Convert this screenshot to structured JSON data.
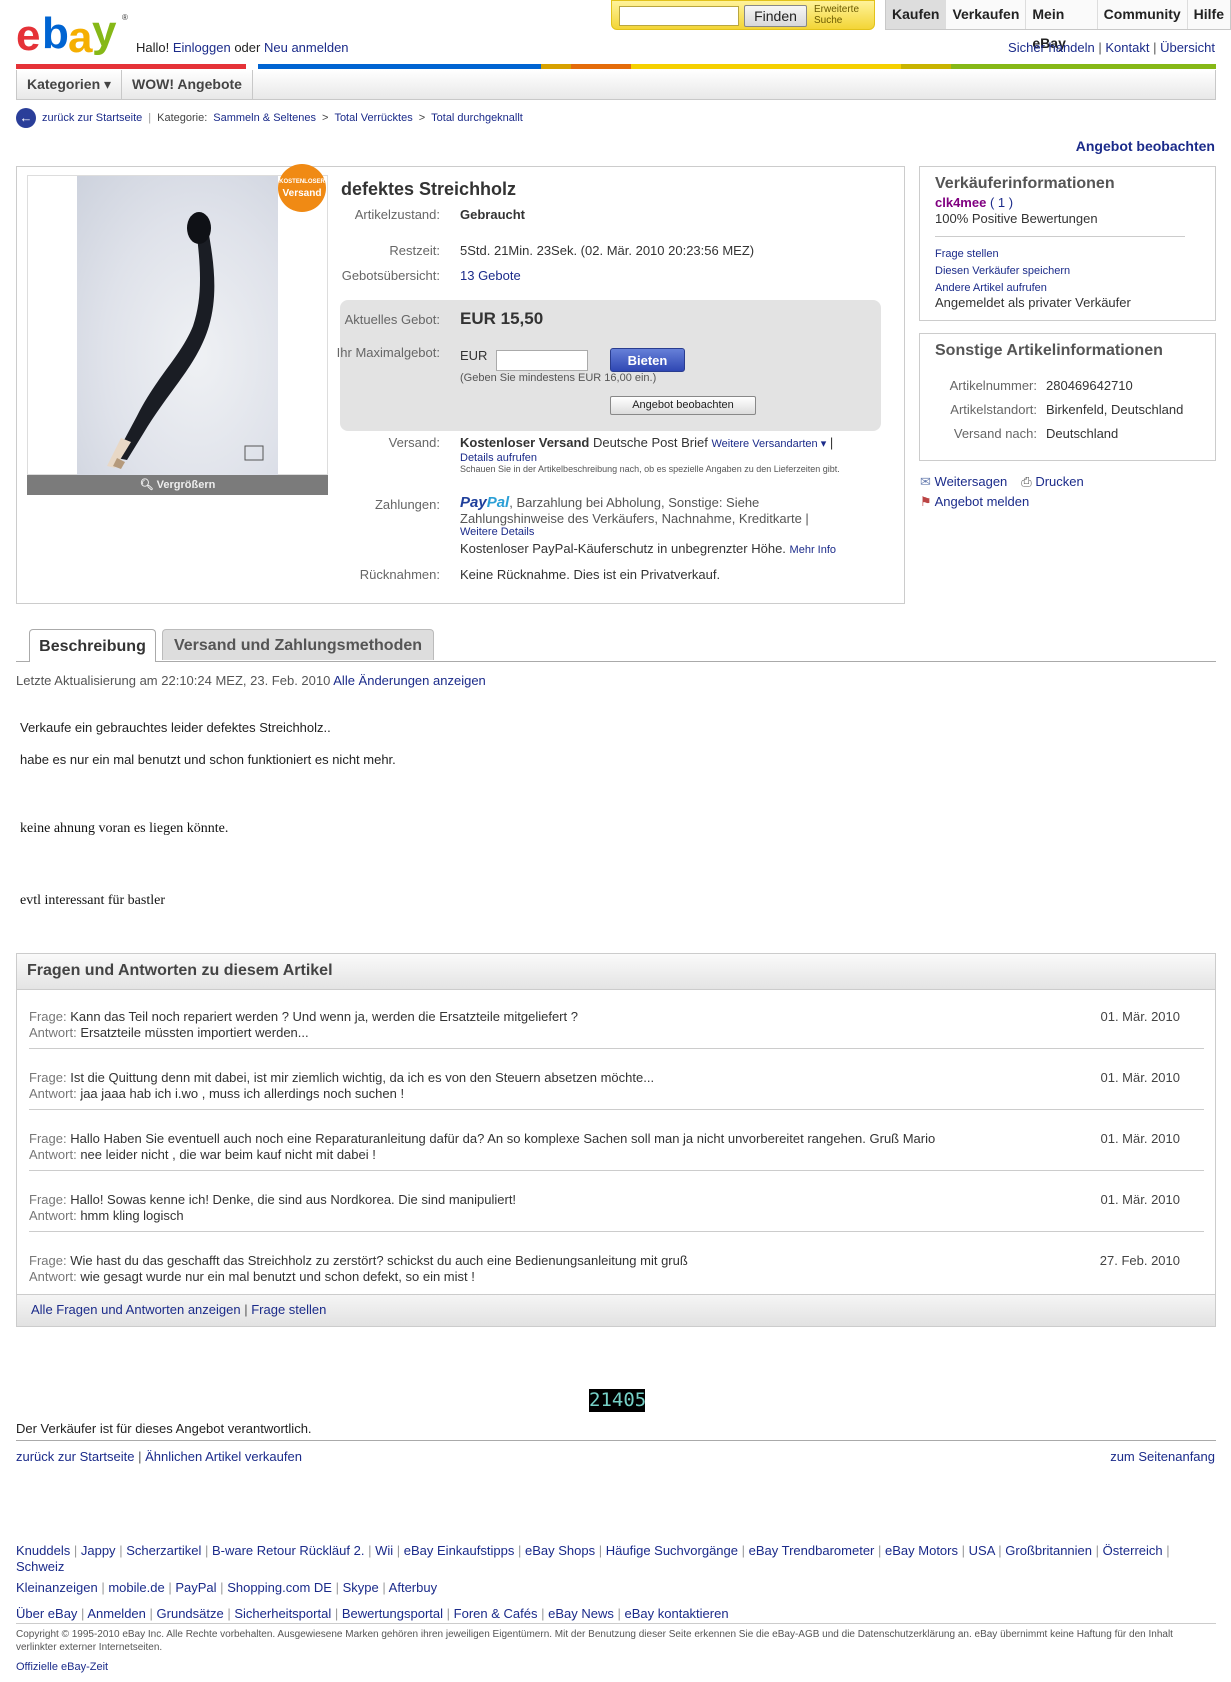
{
  "header": {
    "greeting": "Hallo!",
    "login": "Einloggen",
    "or": "oder",
    "register": "Neu anmelden",
    "search_button": "Finden",
    "advanced_search": [
      "Erweiterte",
      "Suche"
    ],
    "nav": [
      "Kaufen",
      "Verkaufen",
      "Mein eBay",
      "Community",
      "Hilfe"
    ],
    "top_links": [
      "Sicher handeln",
      "Kontakt",
      "Übersicht"
    ],
    "categories_menu": "Kategorien ▾",
    "wow": "WOW! Angebote",
    "logo_letters": [
      "e",
      "b",
      "a",
      "y"
    ],
    "logo_colors": [
      "#e53238",
      "#0064d2",
      "#f5af02",
      "#86b817"
    ]
  },
  "breadcrumb": {
    "back": "zurück zur Startseite",
    "category_label": "Kategorie:",
    "path": [
      "Sammeln & Seltenes",
      "Total Verrücktes",
      "Total durchgeknallt"
    ]
  },
  "watch_top": "Angebot beobachten",
  "item": {
    "title": "defektes Streichholz",
    "free_shipping_badge": [
      "KOSTENLOSER",
      "Versand"
    ],
    "enlarge": "Vergrößern",
    "condition_label": "Artikelzustand:",
    "condition": "Gebraucht",
    "time_left_label": "Restzeit:",
    "time_left": "5Std. 21Min. 23Sek. (02. Mär. 2010 20:23:56 MEZ)",
    "bid_history_label": "Gebotsübersicht:",
    "bid_history": "13 Gebote",
    "current_bid_label": "Aktuelles Gebot:",
    "current_bid": "EUR 15,50",
    "max_bid_label": "Ihr Maximalgebot:",
    "currency": "EUR",
    "bid_button": "Bieten",
    "min_bid_hint": "(Geben Sie mindestens EUR 16,00 ein.)",
    "watch_button": "Angebot beobachten",
    "shipping_label": "Versand:",
    "shipping_free": "Kostenloser Versand",
    "shipping_method": "Deutsche Post Brief",
    "more_shipping": "Weitere Versandarten",
    "details": "Details aufrufen",
    "shipping_note": "Schauen Sie in der Artikelbeschreibung nach, ob es spezielle Angaben zu den Lieferzeiten gibt.",
    "payment_label": "Zahlungen:",
    "paypal_logo": [
      "Pay",
      "Pal"
    ],
    "payment_text": ", Barzahlung bei Abholung, Sonstige: Siehe Zahlungshinweise des Verkäufers, Nachnahme, Kreditkarte |",
    "more_details": "Weitere Details",
    "buyer_protection": "Kostenloser PayPal-Käuferschutz in unbegrenzter Höhe.",
    "more_info": "Mehr Info",
    "returns_label": "Rücknahmen:",
    "returns": "Keine Rücknahme. Dies ist ein Privatverkauf."
  },
  "seller": {
    "title": "Verkäuferinformationen",
    "name": "clk4mee",
    "score": "( 1 )",
    "positive": "100% Positive Bewertungen",
    "links": [
      "Frage stellen",
      "Diesen Verkäufer speichern",
      "Andere Artikel aufrufen"
    ],
    "private": "Angemeldet als privater Verkäufer"
  },
  "other_info": {
    "title": "Sonstige Artikelinformationen",
    "item_number_label": "Artikelnummer:",
    "item_number": "280469642710",
    "location_label": "Artikelstandort:",
    "location": "Birkenfeld, Deutschland",
    "ships_to_label": "Versand nach:",
    "ships_to": "Deutschland"
  },
  "actions": {
    "share": "Weitersagen",
    "print": "Drucken",
    "report": "Angebot melden"
  },
  "tabs": [
    "Beschreibung",
    "Versand und Zahlungsmethoden"
  ],
  "description": {
    "updated": "Letzte Aktualisierung am 22:10:24 MEZ, 23. Feb. 2010",
    "all_changes": "Alle Änderungen anzeigen",
    "line1": "Verkaufe ein gebrauchtes leider defektes Streichholz..",
    "line2": "habe es nur ein mal benutzt und schon funktioniert es nicht mehr.",
    "line3": "keine ahnung voran es liegen könnte.",
    "line4": "evtl interessant für bastler"
  },
  "qa": {
    "title": "Fragen und Antworten zu diesem Artikel",
    "q_label": "Frage:",
    "a_label": "Antwort:",
    "items": [
      {
        "q": "Kann das Teil noch repariert werden ? Und wenn ja, werden die Ersatzteile mitgeliefert ?",
        "a": "Ersatzteile müssten importiert werden...",
        "date": "01. Mär. 2010"
      },
      {
        "q": "Ist die Quittung denn mit dabei, ist mir ziemlich wichtig, da ich es von den Steuern absetzen möchte...",
        "a": "jaa jaaa hab ich i.wo , muss ich allerdings noch suchen !",
        "date": "01. Mär. 2010"
      },
      {
        "q": "Hallo Haben Sie eventuell auch noch eine Reparaturanleitung dafür da? An so komplexe Sachen soll man ja nicht unvorbereitet rangehen. Gruß Mario",
        "a": "nee leider nicht , die war beim kauf nicht mit dabei !",
        "date": "01. Mär. 2010"
      },
      {
        "q": "Hallo! Sowas kenne ich! Denke, die sind aus Nordkorea. Die sind manipuliert!",
        "a": "hmm kling logisch",
        "date": "01. Mär. 2010"
      },
      {
        "q": "Wie hast du das geschafft das Streichholz zu zerstört? schickst du auch eine Bedienungsanleitung mit gruß",
        "a": "wie gesagt wurde nur ein mal benutzt und schon defekt, so ein mist !",
        "date": "27. Feb. 2010"
      }
    ],
    "all_link": "Alle Fragen und Antworten anzeigen",
    "ask_link": "Frage stellen"
  },
  "counter": "21405",
  "responsible": "Der Verkäufer ist für dieses Angebot verantwortlich.",
  "footer_nav": {
    "back": "zurück zur Startseite",
    "sell_similar": "Ähnlichen Artikel verkaufen",
    "top": "zum Seitenanfang"
  },
  "footer_links_1": [
    "Knuddels",
    "Jappy",
    "Scherzartikel",
    "B-ware Retour Rückläuf 2.",
    "Wii",
    "eBay Einkaufstipps",
    "eBay Shops",
    "Häufige Suchvorgänge",
    "eBay Trendbarometer",
    "eBay Motors",
    "USA",
    "Großbritannien",
    "Österreich",
    "Schweiz"
  ],
  "footer_links_2": [
    "Kleinanzeigen",
    "mobile.de",
    "PayPal",
    "Shopping.com DE",
    "Skype",
    "Afterbuy"
  ],
  "footer_links_3": [
    "Über eBay",
    "Anmelden",
    "Grundsätze",
    "Sicherheitsportal",
    "Bewertungsportal",
    "Foren & Cafés",
    "eBay News",
    "eBay kontaktieren"
  ],
  "copyright": "Copyright © 1995-2010 eBay Inc. Alle Rechte vorbehalten. Ausgewiesene Marken gehören ihren jeweiligen Eigentümern. Mit der Benutzung dieser Seite erkennen Sie die eBay-AGB und die Datenschutzerklärung an. eBay übernimmt keine Haftung für den Inhalt verlinkter externer Internetseiten.",
  "official_time": "Offizielle eBay-Zeit"
}
